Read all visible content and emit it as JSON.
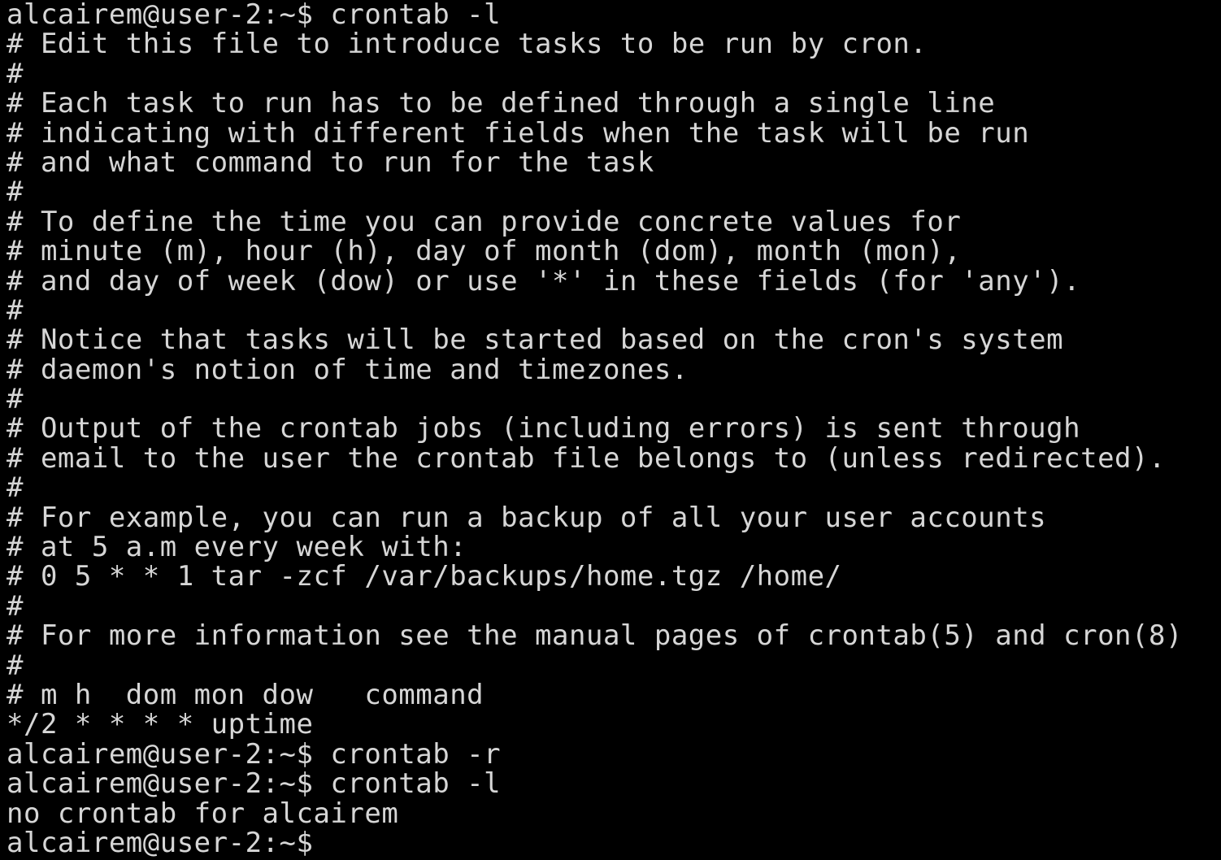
{
  "terminal": {
    "lines": [
      "alcairem@user-2:~$ crontab -l",
      "# Edit this file to introduce tasks to be run by cron.",
      "#",
      "# Each task to run has to be defined through a single line",
      "# indicating with different fields when the task will be run",
      "# and what command to run for the task",
      "#",
      "# To define the time you can provide concrete values for",
      "# minute (m), hour (h), day of month (dom), month (mon),",
      "# and day of week (dow) or use '*' in these fields (for 'any').",
      "#",
      "# Notice that tasks will be started based on the cron's system",
      "# daemon's notion of time and timezones.",
      "#",
      "# Output of the crontab jobs (including errors) is sent through",
      "# email to the user the crontab file belongs to (unless redirected).",
      "#",
      "# For example, you can run a backup of all your user accounts",
      "# at 5 a.m every week with:",
      "# 0 5 * * 1 tar -zcf /var/backups/home.tgz /home/",
      "#",
      "# For more information see the manual pages of crontab(5) and cron(8)",
      "#",
      "# m h  dom mon dow   command",
      "*/2 * * * * uptime",
      "alcairem@user-2:~$ crontab -r",
      "alcairem@user-2:~$ crontab -l",
      "no crontab for alcairem",
      "alcairem@user-2:~$"
    ]
  },
  "colors": {
    "background": "#000000",
    "foreground": "#d6d6d6"
  }
}
